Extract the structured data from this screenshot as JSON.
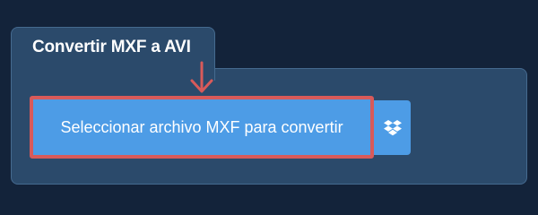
{
  "panel": {
    "title": "Convertir MXF a AVI"
  },
  "upload": {
    "select_label": "Seleccionar archivo MXF para convertir",
    "dropbox_icon": "dropbox-icon"
  },
  "colors": {
    "background": "#13233a",
    "panel": "#2b4a6b",
    "button": "#4d9ce6",
    "highlight": "#d85a5a"
  }
}
